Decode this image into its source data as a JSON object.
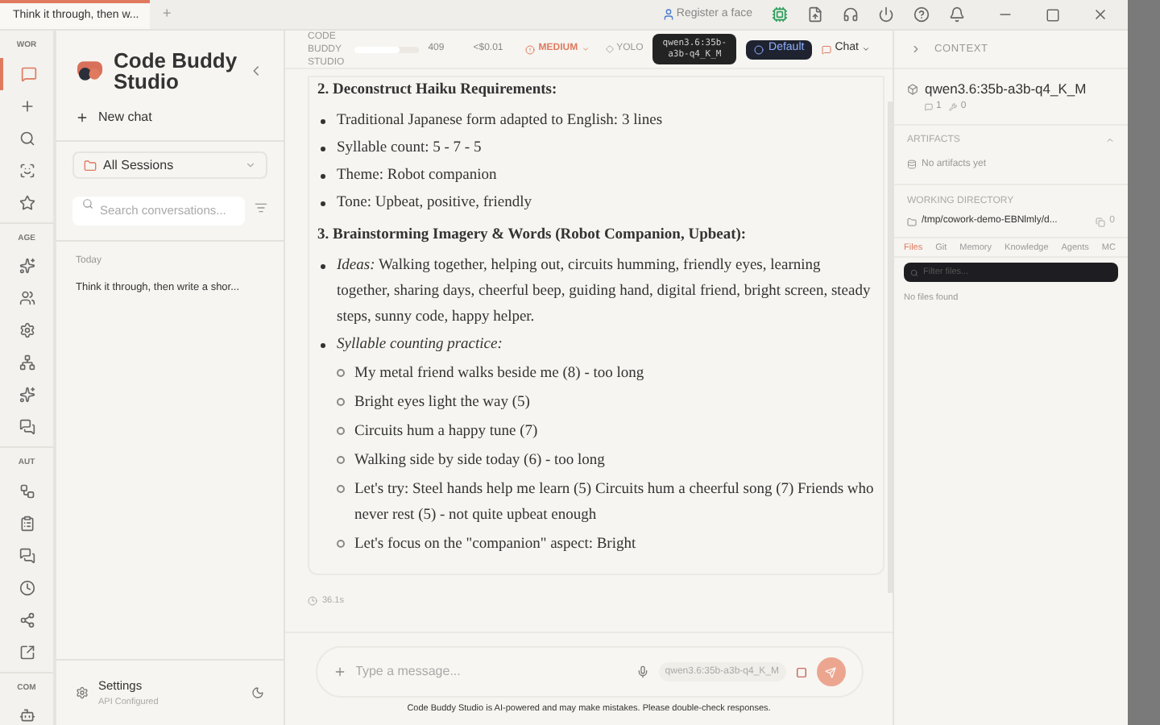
{
  "tab_bar": {
    "tabs": [
      {
        "label": "Think it through, then w...",
        "selected": true
      }
    ],
    "new_tab": "+",
    "register": "Register a face"
  },
  "rail": {
    "sections": [
      {
        "label": "WOR",
        "items": [
          {
            "selected": true
          },
          {
            "selected": false
          },
          {
            "selected": false
          },
          {
            "selected": false
          },
          {
            "selected": false
          }
        ]
      },
      {
        "label": "AGE",
        "items": [
          {
            "selected": false
          },
          {
            "selected": false
          },
          {
            "selected": false
          },
          {
            "selected": false
          },
          {
            "selected": false
          },
          {
            "selected": false
          }
        ]
      },
      {
        "label": "AUT",
        "items": [
          {
            "selected": false
          },
          {
            "selected": false
          },
          {
            "selected": false
          },
          {
            "selected": false
          },
          {
            "selected": false
          },
          {
            "selected": false
          }
        ]
      },
      {
        "label": "COM",
        "items": [
          {
            "selected": false
          }
        ]
      }
    ]
  },
  "sidebar": {
    "app_name": "Code Buddy Studio",
    "new_chat": "New chat",
    "sessions_filter": "All Sessions",
    "search": {
      "placeholder": "Search conversations..."
    },
    "groups": [
      {
        "label": "Today",
        "items": [
          {
            "title": "Think it through, then write a shor...",
            "selected": false
          }
        ]
      }
    ],
    "settings": {
      "label": "Settings",
      "status": "API Configured"
    }
  },
  "header": {
    "brand": "CODE BUDDY STUDIO",
    "tokens": "409",
    "token_meter": {
      "level": 0.7
    },
    "cost": "<$0.01",
    "effort": "MEDIUM",
    "yolo": "YOLO",
    "model": "qwen3.6:35b-a3b-q4_K_M",
    "mode": "Default",
    "chat": "Chat"
  },
  "message": {
    "sections": [
      {
        "heading": "2. Deconstruct Haiku Requirements:",
        "bullets": [
          {
            "text": "Traditional Japanese form adapted to English: 3 lines"
          },
          {
            "text": "Syllable count: 5 - 7 - 5"
          },
          {
            "text": "Theme: Robot companion"
          },
          {
            "text": "Tone: Upbeat, positive, friendly"
          }
        ]
      },
      {
        "heading": "3. Brainstorming Imagery & Words (Robot Companion, Upbeat):",
        "bullets": [
          {
            "text": "*Ideas:* Walking together, helping out, circuits humming, friendly eyes, learning together, sharing days, cheerful beep, guiding hand, digital friend, bright screen, steady steps, sunny code, happy helper."
          },
          {
            "text": "*Syllable counting practice:*",
            "children": [
              {
                "text": "My metal friend walks beside me (8) - too long"
              },
              {
                "text": "Bright eyes light the way (5)"
              },
              {
                "text": "Circuits hum a happy tune (7)"
              },
              {
                "text": "Walking side by side today (6) - too long"
              },
              {
                "text": "Let's try: Steel hands help me learn (5) Circuits hum a cheerful song (7) Friends who never rest (5) - not quite upbeat enough"
              },
              {
                "text": "Let's focus on the \"companion\" aspect: Bright"
              }
            ]
          }
        ]
      }
    ],
    "duration": "36.1s"
  },
  "composer": {
    "placeholder": "Type a message...",
    "model": "qwen3.6:35b-a3b-q4_K_M",
    "disclaimer": "Code Buddy Studio is AI-powered and may make mistakes. Please double-check responses."
  },
  "context": {
    "title": "CONTEXT",
    "model": "qwen3.6:35b-a3b-q4_K_M",
    "messages": "1",
    "tools": "0",
    "artifacts": {
      "title": "ARTIFACTS",
      "empty": "No artifacts yet",
      "expanded": true
    },
    "working_directory": {
      "title": "WORKING DIRECTORY",
      "path": "/tmp/cowork-demo-EBNlmly/d...",
      "count": "0"
    },
    "tabs": [
      {
        "label": "Files",
        "selected": true
      },
      {
        "label": "Git",
        "selected": false
      },
      {
        "label": "Memory",
        "selected": false
      },
      {
        "label": "Knowledge",
        "selected": false
      },
      {
        "label": "Agents",
        "selected": false
      },
      {
        "label": "MC",
        "selected": false
      }
    ],
    "filter": {
      "placeholder": "Filter files..."
    },
    "empty": "No files found"
  }
}
